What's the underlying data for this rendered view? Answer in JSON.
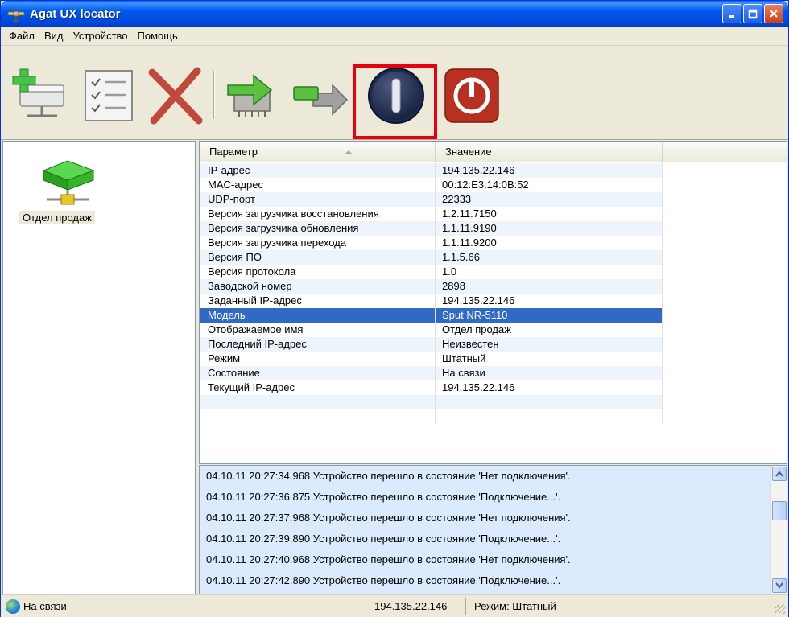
{
  "window": {
    "title": "Agat UX locator"
  },
  "menu": {
    "items": [
      "Файл",
      "Вид",
      "Устройство",
      "Помощь"
    ]
  },
  "toolbar": {
    "buttons": [
      {
        "icon": "add-device-icon"
      },
      {
        "icon": "properties-list-icon"
      },
      {
        "icon": "delete-x-icon"
      },
      {
        "icon": "upload-firmware-icon"
      },
      {
        "icon": "transfer-arrow-icon"
      },
      {
        "icon": "power-on-icon"
      },
      {
        "icon": "power-off-icon"
      }
    ]
  },
  "devices": [
    {
      "label": "Отдел продаж",
      "icon": "network-device-icon"
    }
  ],
  "table": {
    "columns": [
      "Параметр",
      "Значение"
    ],
    "rows": [
      [
        "IP-адрес",
        "194.135.22.146"
      ],
      [
        "MAC-адрес",
        "00:12:E3:14:0B:52"
      ],
      [
        "UDP-порт",
        "22333"
      ],
      [
        "Версия загрузчика восстановления",
        "1.2.11.7150"
      ],
      [
        "Версия загрузчика обновления",
        "1.1.11.9190"
      ],
      [
        "Версия загрузчика перехода",
        "1.1.11.9200"
      ],
      [
        "Версия ПО",
        "1.1.5.66"
      ],
      [
        "Версия протокола",
        "1.0"
      ],
      [
        "Заводской номер",
        "2898"
      ],
      [
        "Заданный IP-адрес",
        "194.135.22.146"
      ],
      [
        "Модель",
        "Sput NR-5110"
      ],
      [
        "Отображаемое имя",
        "Отдел продаж"
      ],
      [
        "Последний IP-адрес",
        "Неизвестен"
      ],
      [
        "Режим",
        "Штатный"
      ],
      [
        "Состояние",
        "На связи"
      ],
      [
        "Текущий IP-адрес",
        "194.135.22.146"
      ],
      [
        "",
        ""
      ],
      [
        "",
        ""
      ]
    ],
    "selected_row": "Модель"
  },
  "log": [
    "04.10.11 20:27:34.968 Устройство перешло в состояние 'Нет подключения'.",
    "04.10.11 20:27:36.875 Устройство перешло в состояние 'Подключение...'.",
    "04.10.11 20:27:37.968 Устройство перешло в состояние 'Нет подключения'.",
    "04.10.11 20:27:39.890 Устройство перешло в состояние 'Подключение...'.",
    "04.10.11 20:27:40.968 Устройство перешло в состояние 'Нет подключения'.",
    "04.10.11 20:27:42.890 Устройство перешло в состояние 'Подключение...'."
  ],
  "status": {
    "connection": "На связи",
    "ip": "194.135.22.146",
    "mode": "Режим: Штатный"
  },
  "colors": {
    "selection": "#316ac5",
    "highlight": "#e8000f",
    "log_bg": "#dceafd"
  }
}
